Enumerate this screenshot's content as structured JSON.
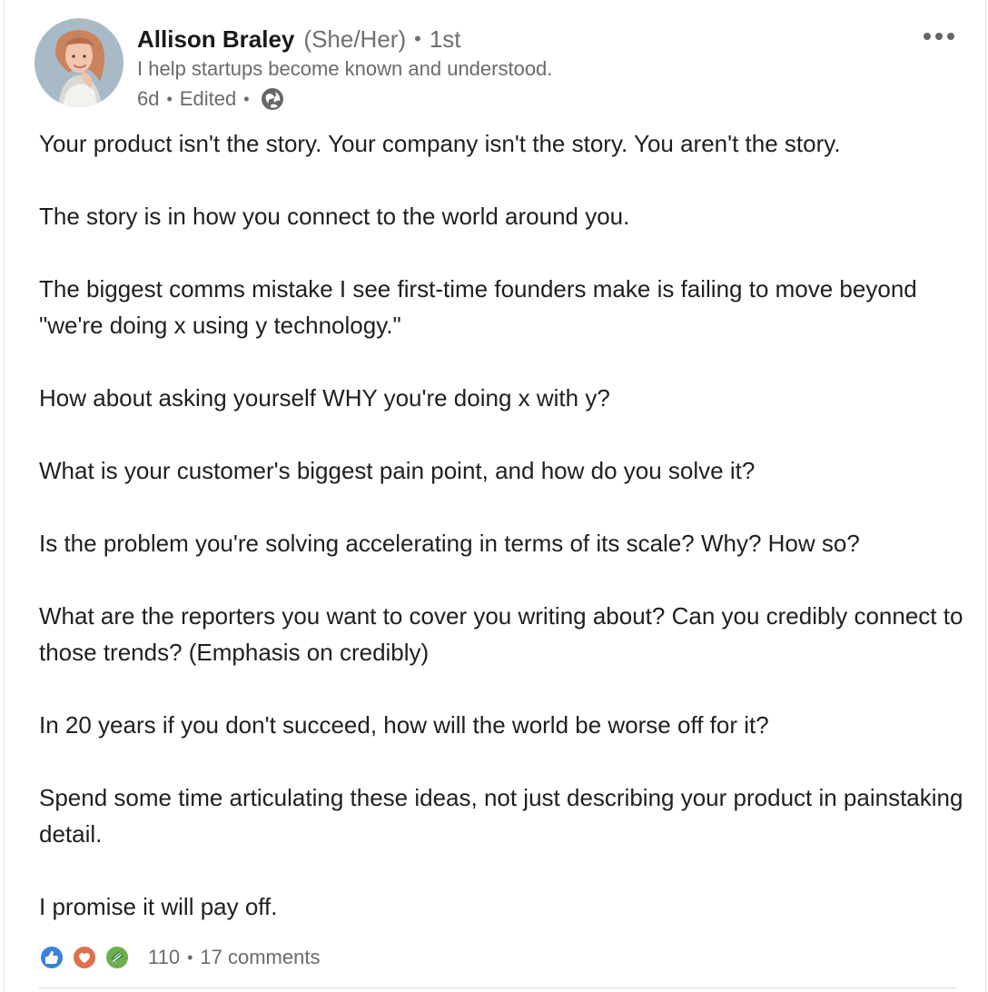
{
  "post": {
    "author": {
      "name": "Allison Braley",
      "pronouns": "(She/Her)",
      "connection": "1st",
      "headline": "I help startups become known and understood.",
      "time": "6d",
      "edited": "Edited",
      "avatar_icon": "profile-photo-avatar-icon",
      "visibility_icon": "globe-icon"
    },
    "more_options_icon": "ellipsis-icon",
    "paragraphs": [
      "Your product isn't the story. Your company isn't the story. You aren't the story.",
      "The story is in how you connect to the world around you.",
      "The biggest comms mistake I see first-time founders make is failing to move beyond \"we're doing x using y technology.\"",
      "How about asking yourself WHY you're doing x with y?",
      "What is your customer's biggest pain point, and how do you solve it?",
      "Is the problem you're solving accelerating in terms of its scale? Why? How so?",
      "What are the reporters you want to cover you writing about? Can you credibly connect to those trends? (Emphasis on credibly)",
      "In 20 years if you don't succeed, how will the world be worse off for it?",
      "Spend some time articulating these ideas, not just describing your product in painstaking detail.",
      "I promise it will pay off."
    ],
    "social": {
      "reaction_icons": [
        "like-icon",
        "love-icon",
        "support-icon"
      ],
      "reactions_count": "110",
      "comments": "17 comments"
    },
    "colors": {
      "like": "#3b82d6",
      "love": "#df704d",
      "support": "#6dae4f",
      "secondary_text": "#6b6b6b"
    }
  }
}
